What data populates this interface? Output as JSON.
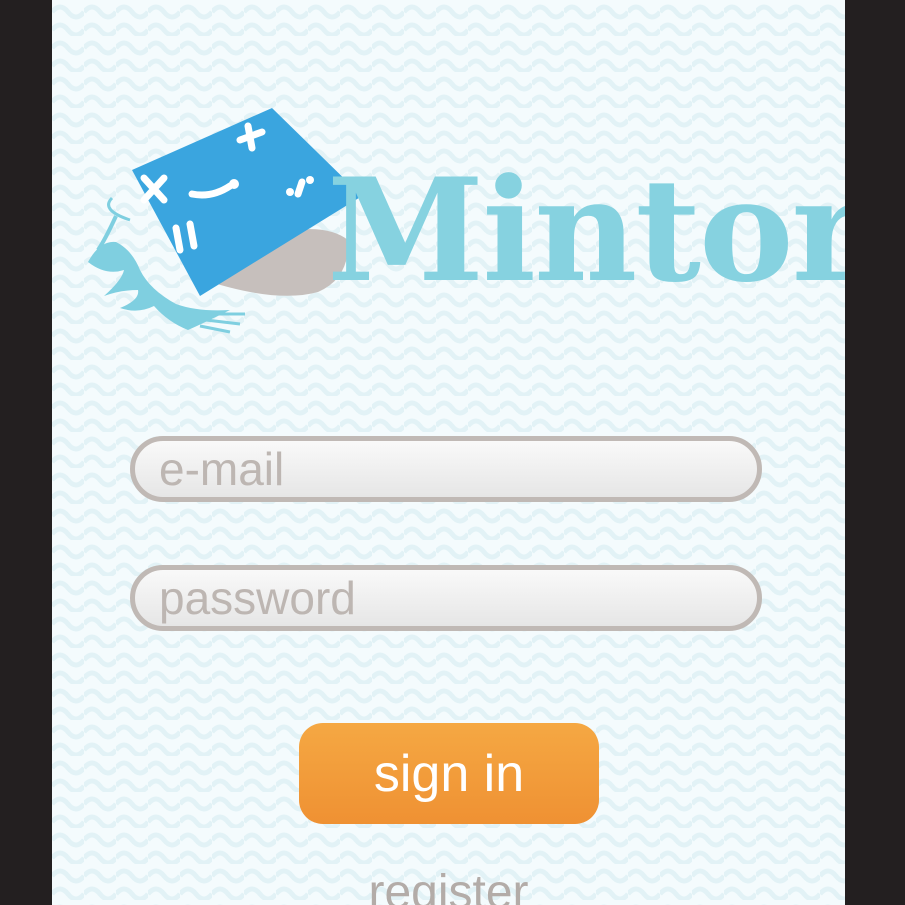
{
  "logo": {
    "brand_name": "Mintor",
    "brand_color": "#86d2e0",
    "cap_color": "#3aa5df",
    "tassel_color": "#7fcfe0",
    "icon": "graduation-cap-icon"
  },
  "login": {
    "email_placeholder": "e-mail",
    "email_value": "",
    "password_placeholder": "password",
    "password_value": "",
    "sign_in_label": "sign in",
    "register_label": "register"
  },
  "colors": {
    "background": "#f4fbfd",
    "frame": "#231f20",
    "button": "#f29c38",
    "field_border": "#c0b9b5",
    "placeholder": "#bdb6b2"
  }
}
